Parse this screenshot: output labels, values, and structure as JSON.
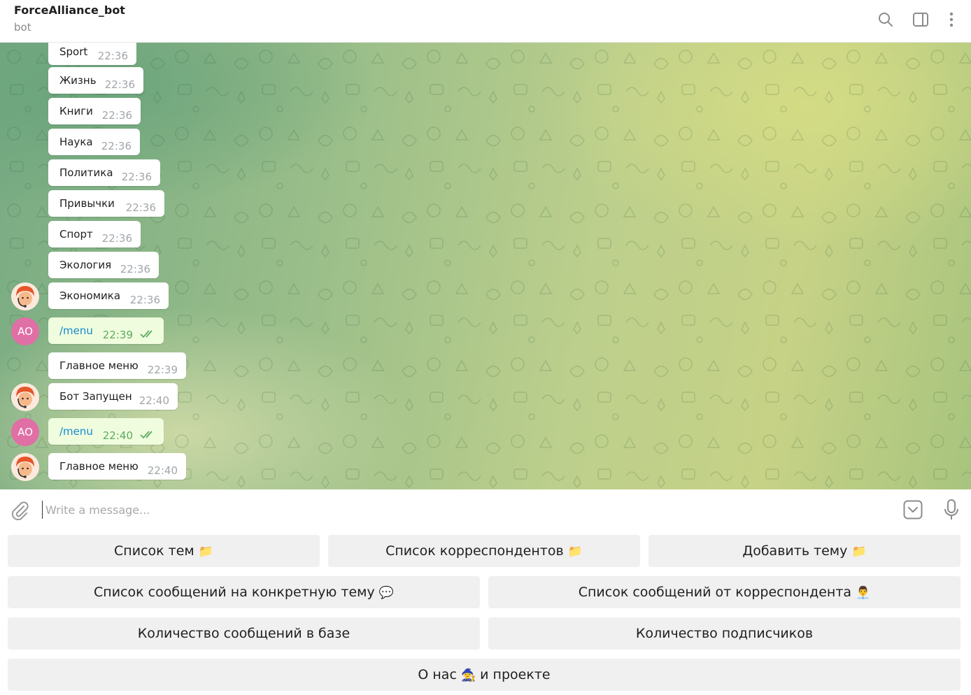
{
  "header": {
    "title": "ForceAlliance_bot",
    "subtitle": "bot"
  },
  "messages": [
    {
      "text": "Sport",
      "time": "22:36"
    },
    {
      "text": "Жизнь",
      "time": "22:36"
    },
    {
      "text": "Книги",
      "time": "22:36"
    },
    {
      "text": "Наука",
      "time": "22:36"
    },
    {
      "text": "Политика",
      "time": "22:36"
    },
    {
      "text": "Привычки",
      "time": "22:36"
    },
    {
      "text": "Спорт",
      "time": "22:36"
    },
    {
      "text": "Экология",
      "time": "22:36"
    },
    {
      "text": "Экономика",
      "time": "22:36"
    },
    {
      "text": "/menu",
      "time": "22:39"
    },
    {
      "text": "Главное меню",
      "time": "22:39"
    },
    {
      "text": "Бот Запущен",
      "time": "22:40"
    },
    {
      "text": "/menu",
      "time": "22:40"
    },
    {
      "text": "Главное меню",
      "time": "22:40"
    }
  ],
  "user_avatar_initials": "AO",
  "composer": {
    "placeholder": "Write a message..."
  },
  "keyboard": {
    "row1": [
      "Список тем",
      "Список корреспондентов",
      "Добавить тему"
    ],
    "row2": [
      "Список сообщений на конкретную тему",
      "Список сообщений от корреспондента"
    ],
    "row3": [
      "Количество сообщений в базе",
      "Количество подписчиков"
    ],
    "row4": {
      "before": "О нас",
      "after": "и проекте"
    },
    "emojis": {
      "folder": "📁",
      "speech": "💬",
      "office_worker": "👨‍💼",
      "wizard": "🧙"
    }
  },
  "colors": {
    "outgoing_bubble": "#effdde",
    "command_link": "#168acd",
    "read_checks": "#5fa95f",
    "avatar_ao": "#e06fa5"
  }
}
